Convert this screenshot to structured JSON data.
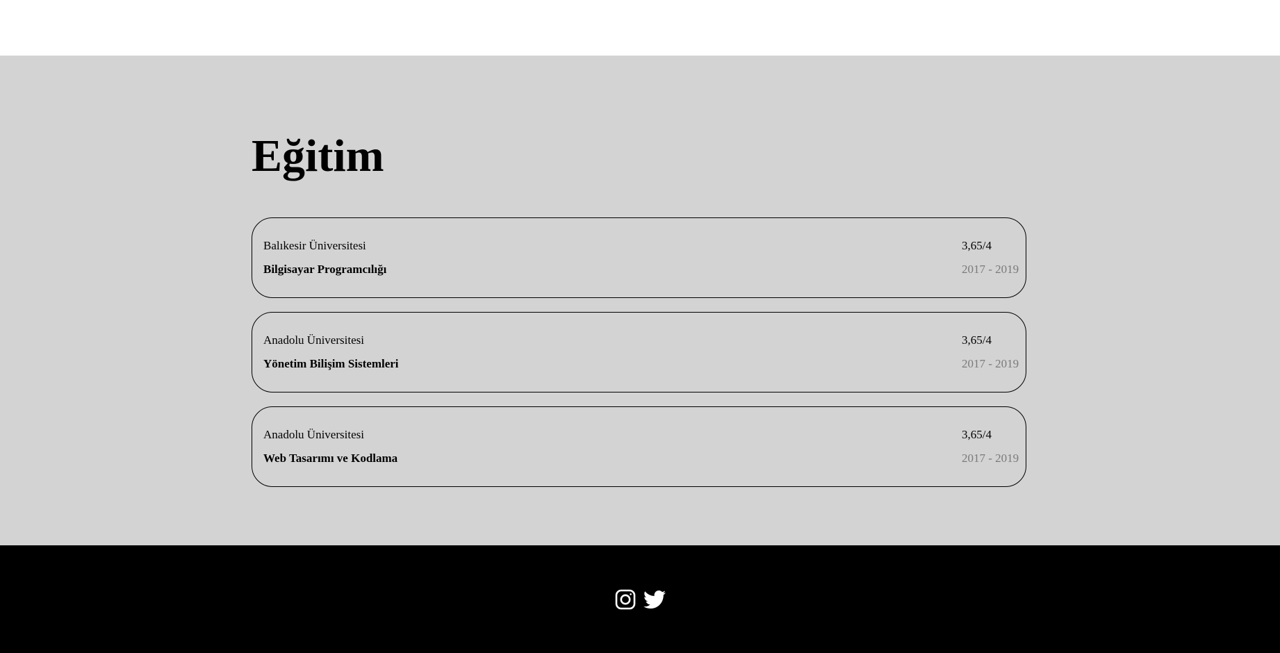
{
  "education": {
    "title": "Eğitim",
    "items": [
      {
        "school": "Balıkesir Üniversitesi",
        "department": "Bilgisayar Programcılığı",
        "gpa": "3,65/4",
        "years": "2017 - 2019"
      },
      {
        "school": "Anadolu Üniversitesi",
        "department": "Yönetim Bilişim Sistemleri",
        "gpa": "3,65/4",
        "years": "2017 - 2019"
      },
      {
        "school": "Anadolu Üniversitesi",
        "department": "Web Tasarımı ve Kodlama",
        "gpa": "3,65/4",
        "years": "2017 - 2019"
      }
    ]
  },
  "footer": {
    "icons": [
      "instagram-icon",
      "twitter-icon"
    ]
  },
  "colors": {
    "section_background": "#d3d3d3",
    "footer_background": "#000000",
    "years_text": "#7a7a7a"
  }
}
